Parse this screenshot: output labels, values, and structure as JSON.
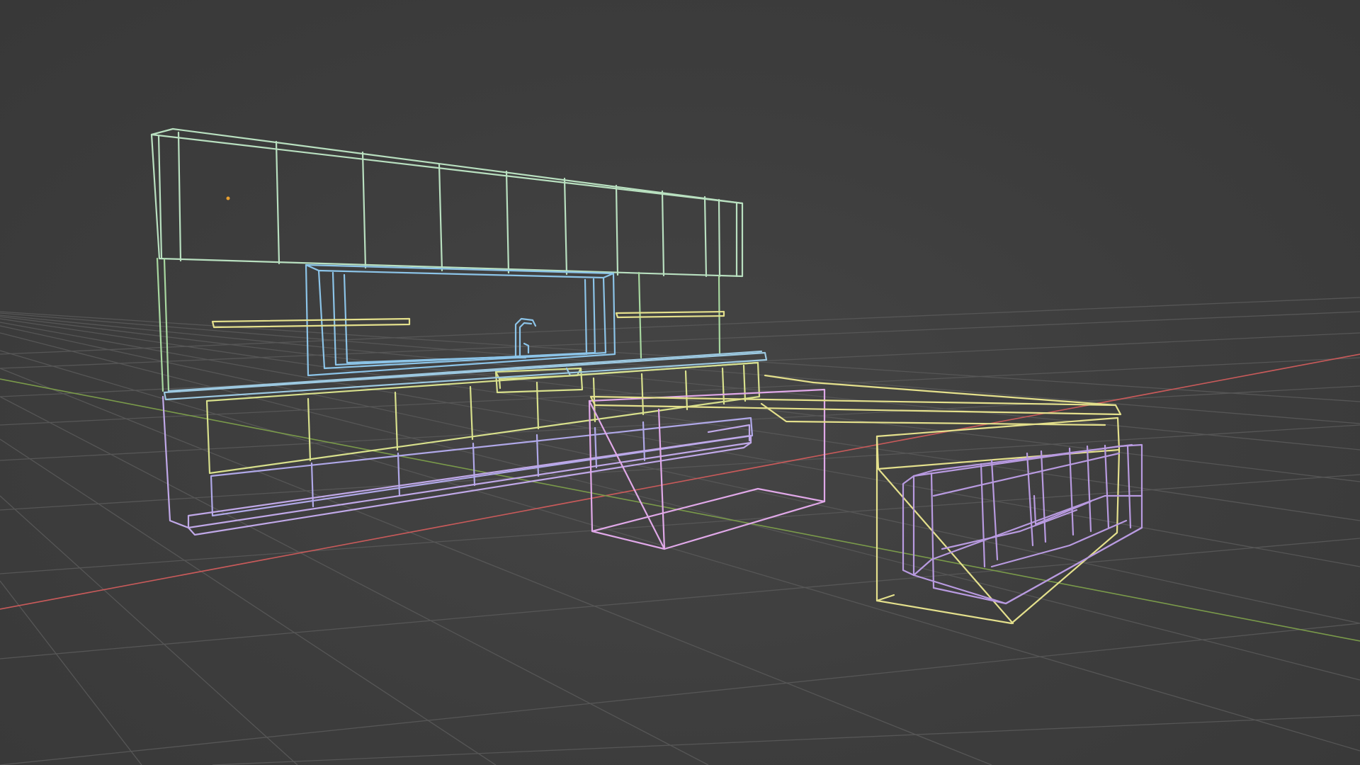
{
  "viewport": {
    "mode": "wireframe",
    "background_color": "#3d3d3d",
    "grid_color": "#565656",
    "x_axis_color": "#c85a5a",
    "y_axis_color": "#7a9a4a",
    "origin_marker_color": "#e8a030"
  },
  "scene_objects": [
    {
      "name": "wall-cabinets",
      "wire_color": "#b9e0c0"
    },
    {
      "name": "back-panel",
      "wire_color": "#a8d8a0"
    },
    {
      "name": "window-recess",
      "wire_color": "#8cc4e8"
    },
    {
      "name": "left-shelf",
      "wire_color": "#e4e08c"
    },
    {
      "name": "right-shelf",
      "wire_color": "#e4e08c"
    },
    {
      "name": "faucet",
      "wire_color": "#8cc4e8"
    },
    {
      "name": "sink",
      "wire_color": "#d8e08c"
    },
    {
      "name": "countertop",
      "wire_color": "#9cc8e0"
    },
    {
      "name": "base-drawers-upper",
      "wire_color": "#d8e08c"
    },
    {
      "name": "base-drawers-lower",
      "wire_color": "#b0a8e8"
    },
    {
      "name": "plinth",
      "wire_color": "#c0a8e8"
    },
    {
      "name": "side-cabinet",
      "wire_color": "#e0a8e8"
    },
    {
      "name": "bar-bench",
      "wire_color": "#e4e08c"
    },
    {
      "name": "island-frame",
      "wire_color": "#e4e08c"
    },
    {
      "name": "island-inner",
      "wire_color": "#b89ae0"
    }
  ]
}
